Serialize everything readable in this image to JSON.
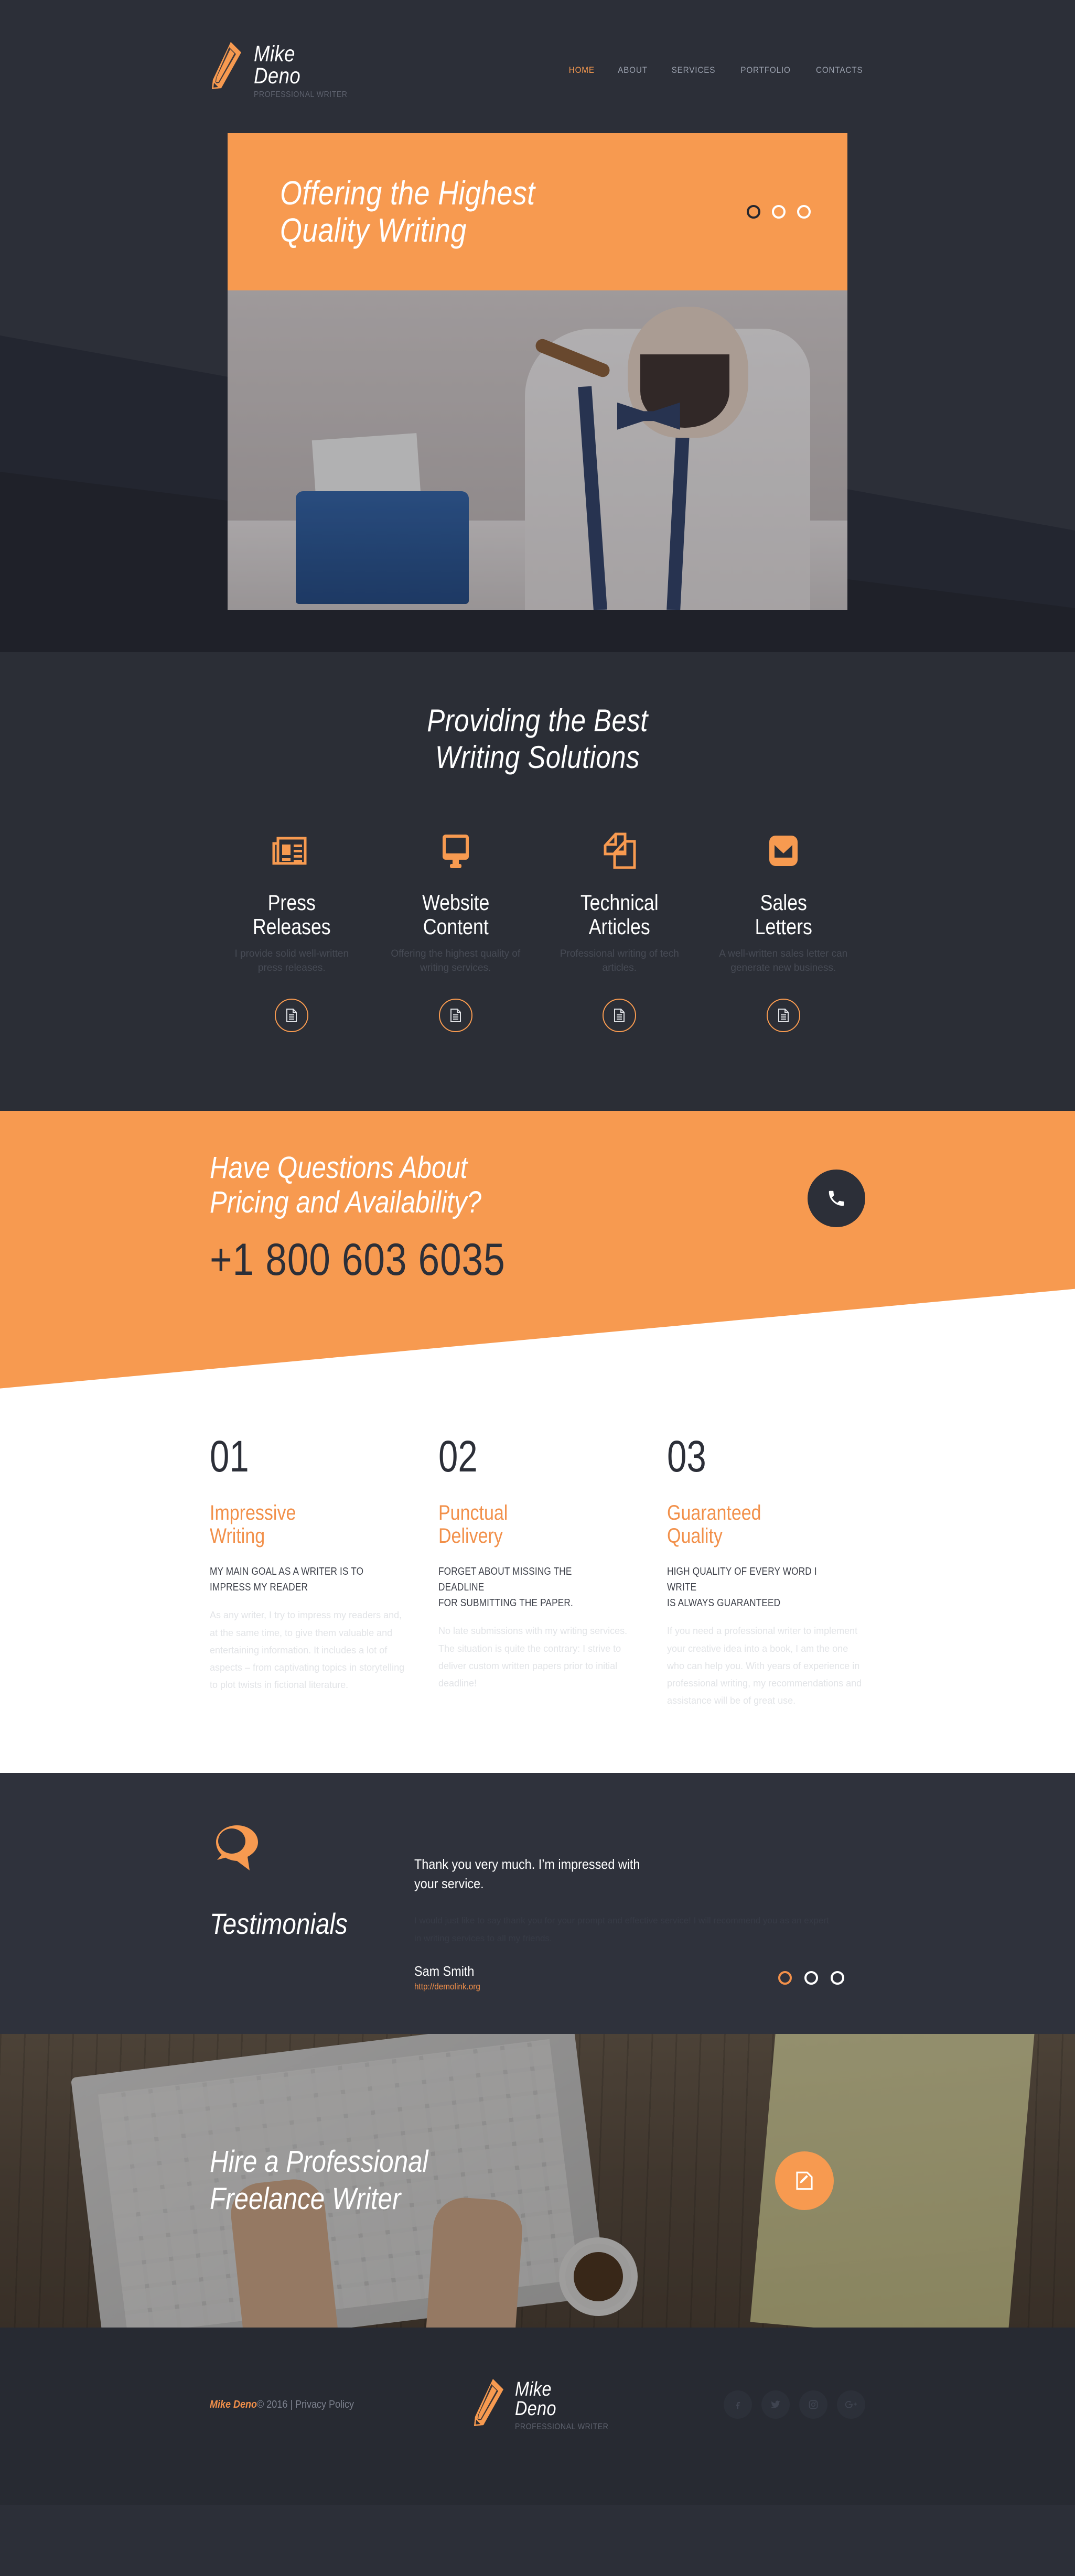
{
  "brand": {
    "line1": "Mike",
    "line2": "Deno",
    "tagline": "PROFESSIONAL WRITER",
    "logo_icon": "pencil-icon"
  },
  "nav": {
    "items": [
      {
        "label": "HOME",
        "active": true
      },
      {
        "label": "ABOUT",
        "active": false
      },
      {
        "label": "SERVICES",
        "active": false
      },
      {
        "label": "PORTFOLIO",
        "active": false
      },
      {
        "label": "CONTACTS",
        "active": false
      }
    ]
  },
  "hero": {
    "title_line1": "Offering the Highest",
    "title_line2": "Quality Writing",
    "slides": [
      "slide-1",
      "slide-2",
      "slide-3"
    ],
    "active_slide": 1
  },
  "services": {
    "title_line1": "Providing the Best",
    "title_line2": "Writing Solutions",
    "items": [
      {
        "icon": "newspaper-icon",
        "title_line1": "Press",
        "title_line2": "Releases",
        "description": "I provide solid well-written press releases.",
        "more_icon": "document-icon"
      },
      {
        "icon": "monitor-icon",
        "title_line1": "Website",
        "title_line2": "Content",
        "description": "Offering the highest quality of writing services.",
        "more_icon": "document-icon"
      },
      {
        "icon": "pages-icon",
        "title_line1": "Technical",
        "title_line2": "Articles",
        "description": "Professional writing of tech articles.",
        "more_icon": "document-icon"
      },
      {
        "icon": "envelope-icon",
        "title_line1": "Sales",
        "title_line2": "Letters",
        "description": "A well-written sales letter can generate new business.",
        "more_icon": "document-icon"
      }
    ]
  },
  "cta": {
    "title_line1": "Have Questions About",
    "title_line2": "Pricing and Availability?",
    "phone": "+1 800 603 6035",
    "button_icon": "phone-icon"
  },
  "features": {
    "items": [
      {
        "number": "01",
        "title_line1": "Impressive",
        "title_line2": "Writing",
        "subtitle_line1": "MY MAIN GOAL AS A WRITER IS TO",
        "subtitle_line2": "IMPRESS MY READER",
        "body": "As any writer, I try to impress my readers and, at the same time, to give them valuable and entertaining information. It includes a lot of aspects – from captivating topics in storytelling to plot twists in fictional literature."
      },
      {
        "number": "02",
        "title_line1": "Punctual",
        "title_line2": "Delivery",
        "subtitle_line1": "FORGET ABOUT MISSING THE DEADLINE",
        "subtitle_line2": "FOR SUBMITTING THE PAPER.",
        "body": "No late submissions with my writing services. The situation is quite the contrary: I strive to deliver custom written papers prior to initial deadline!"
      },
      {
        "number": "03",
        "title_line1": "Guaranteed",
        "title_line2": "Quality",
        "subtitle_line1": "HIGH QUALITY OF EVERY WORD I WRITE",
        "subtitle_line2": "IS ALWAYS GUARANTEED",
        "body": "If you need a professional writer to implement your creative idea into a book, I am the one who can help you. With years of experience in professional writing, my recommendations and assistance will be of great use."
      }
    ]
  },
  "testimonials": {
    "icon": "quote-bubble-icon",
    "title": "Testimonials",
    "quote_line1": "Thank you very much. I’m impressed with",
    "quote_line2": "your service.",
    "body_line1": "I would just like to say thank you for your prompt and effective service! I will recommend you as an expert",
    "body_line2": "in writing services to all my friends.",
    "author": "Sam Smith",
    "author_url": "http://demolink.org",
    "slides": [
      "t-1",
      "t-2",
      "t-3"
    ],
    "active_slide": 1
  },
  "hire": {
    "title_line1": "Hire a Professional",
    "title_line2": "Freelance Writer",
    "button_icon": "pencil-square-icon"
  },
  "footer": {
    "copyright_brand": "Mike Deno",
    "copyright_rest": "© 2016 | ",
    "privacy_label": "Privacy Policy",
    "socials": [
      {
        "name": "facebook-icon",
        "glyph": "f"
      },
      {
        "name": "twitter-icon",
        "glyph": "t"
      },
      {
        "name": "instagram-icon",
        "glyph": "i"
      },
      {
        "name": "google-plus-icon",
        "glyph": "g"
      }
    ]
  },
  "colors": {
    "accent": "#f79a50",
    "dark": "#2c2f38",
    "darker": "#232630",
    "white": "#ffffff"
  }
}
